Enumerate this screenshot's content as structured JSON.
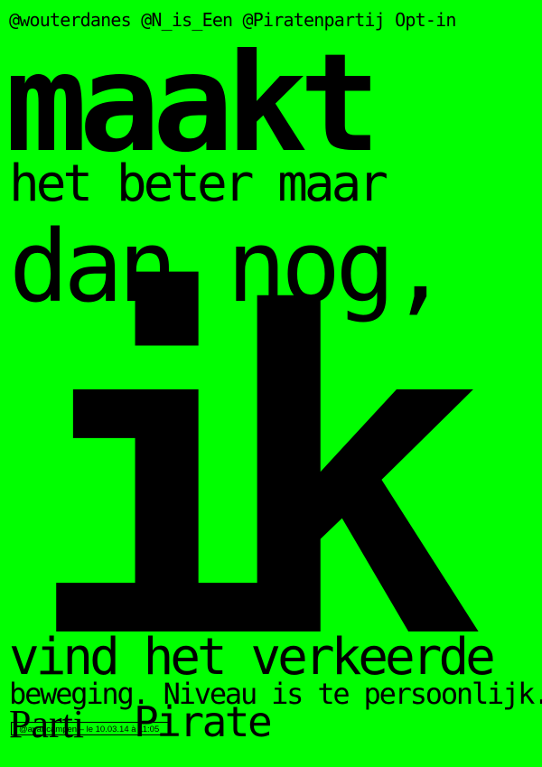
{
  "poster": {
    "background_color": "#00ff00",
    "text_color": "#000000",
    "handles": "@wouterdanes @N_is_Een @Piratenpartij Opt-in",
    "line_maakt": "maakt",
    "line_beter": "het beter maar",
    "line_dannog": "dan nog,",
    "line_ik": "ik",
    "line_verkeerde": "vind het verkeerde",
    "line_beweging": "beweging. Niveau is te persoonlijk.",
    "logo_parti": "Parti",
    "logo_pirate": "Pirate",
    "credit": "@avancampen – le 10.03.14 à 11:05"
  }
}
